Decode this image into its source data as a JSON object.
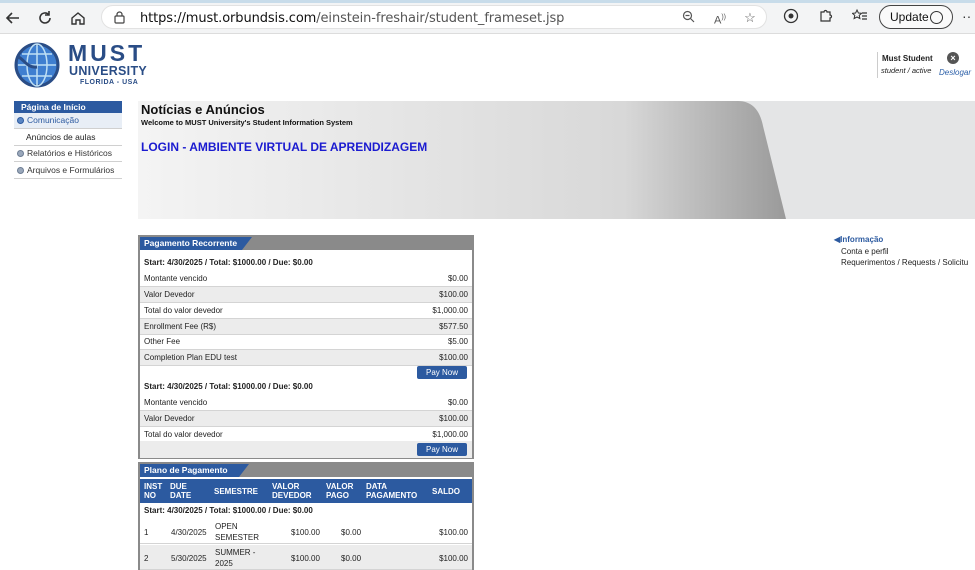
{
  "browser": {
    "url_host": "https://must.orbundsis.com",
    "url_path": "/einstein-freshair/student_frameset.jsp",
    "update_label": "Update"
  },
  "header": {
    "logo_line1": "MUST",
    "logo_line2": "UNIVERSITY",
    "logo_line3": "FLORIDA - USA",
    "user_name": "Must Student",
    "user_status": "student / active",
    "logout_label": "Deslogar"
  },
  "sidebar": {
    "header": "Página de Início",
    "items": [
      {
        "label": "Comunicação"
      },
      {
        "label": "Anúncios de aulas"
      },
      {
        "label": "Relatórios e Históricos"
      },
      {
        "label": "Arquivos e Formulários"
      }
    ]
  },
  "banner": {
    "title": "Notícias e Anúncios",
    "subtitle": "Welcome to MUST University's Student Information System",
    "login": "LOGIN - AMBIENTE VIRTUAL DE APRENDIZAGEM"
  },
  "recurring": {
    "title": "Pagamento Recorrente",
    "pay_label": "Pay Now",
    "group1": {
      "header": "Start: 4/30/2025 / Total: $1000.00 / Due: $0.00",
      "rows": [
        {
          "label": "Montante vencido",
          "value": "$0.00"
        },
        {
          "label": "Valor Devedor",
          "value": "$100.00"
        },
        {
          "label": "Total do valor devedor",
          "value": "$1,000.00"
        },
        {
          "label": "Enrollment Fee (R$)",
          "value": "$577.50"
        },
        {
          "label": "Other Fee",
          "value": "$5.00"
        },
        {
          "label": "Completion Plan EDU test",
          "value": "$100.00"
        }
      ]
    },
    "group2": {
      "header": "Start: 4/30/2025 / Total: $1000.00 / Due: $0.00",
      "rows": [
        {
          "label": "Montante vencido",
          "value": "$0.00"
        },
        {
          "label": "Valor Devedor",
          "value": "$100.00"
        },
        {
          "label": "Total do valor devedor",
          "value": "$1,000.00"
        }
      ]
    }
  },
  "plan": {
    "title": "Plano de Pagamento",
    "columns": {
      "inst_no_1": "INST",
      "inst_no_2": "NO",
      "due_1": "DUE",
      "due_2": "DATE",
      "semester": "SEMESTRE",
      "valor_dev_1": "VALOR",
      "valor_dev_2": "DEVEDOR",
      "valor_pago_1": "VALOR",
      "valor_pago_2": "PAGO",
      "data_pag_1": "DATA",
      "data_pag_2": "PAGAMENTO",
      "saldo": "SALDO"
    },
    "group_header": "Start: 4/30/2025 / Total: $1000.00 / Due: $0.00",
    "rows": [
      {
        "no": "1",
        "due": "4/30/2025",
        "sem1": "OPEN",
        "sem2": "SEMESTER",
        "devedor": "$100.00",
        "pago": "$0.00",
        "data": "",
        "saldo": "$100.00"
      },
      {
        "no": "2",
        "due": "5/30/2025",
        "sem1": "SUMMER -",
        "sem2": "2025",
        "devedor": "$100.00",
        "pago": "$0.00",
        "data": "",
        "saldo": "$100.00"
      }
    ]
  },
  "info": {
    "title": "Informação",
    "links": [
      {
        "label": "Conta e perfil"
      },
      {
        "label": "Requerimentos / Requests / Solicitu"
      }
    ]
  }
}
